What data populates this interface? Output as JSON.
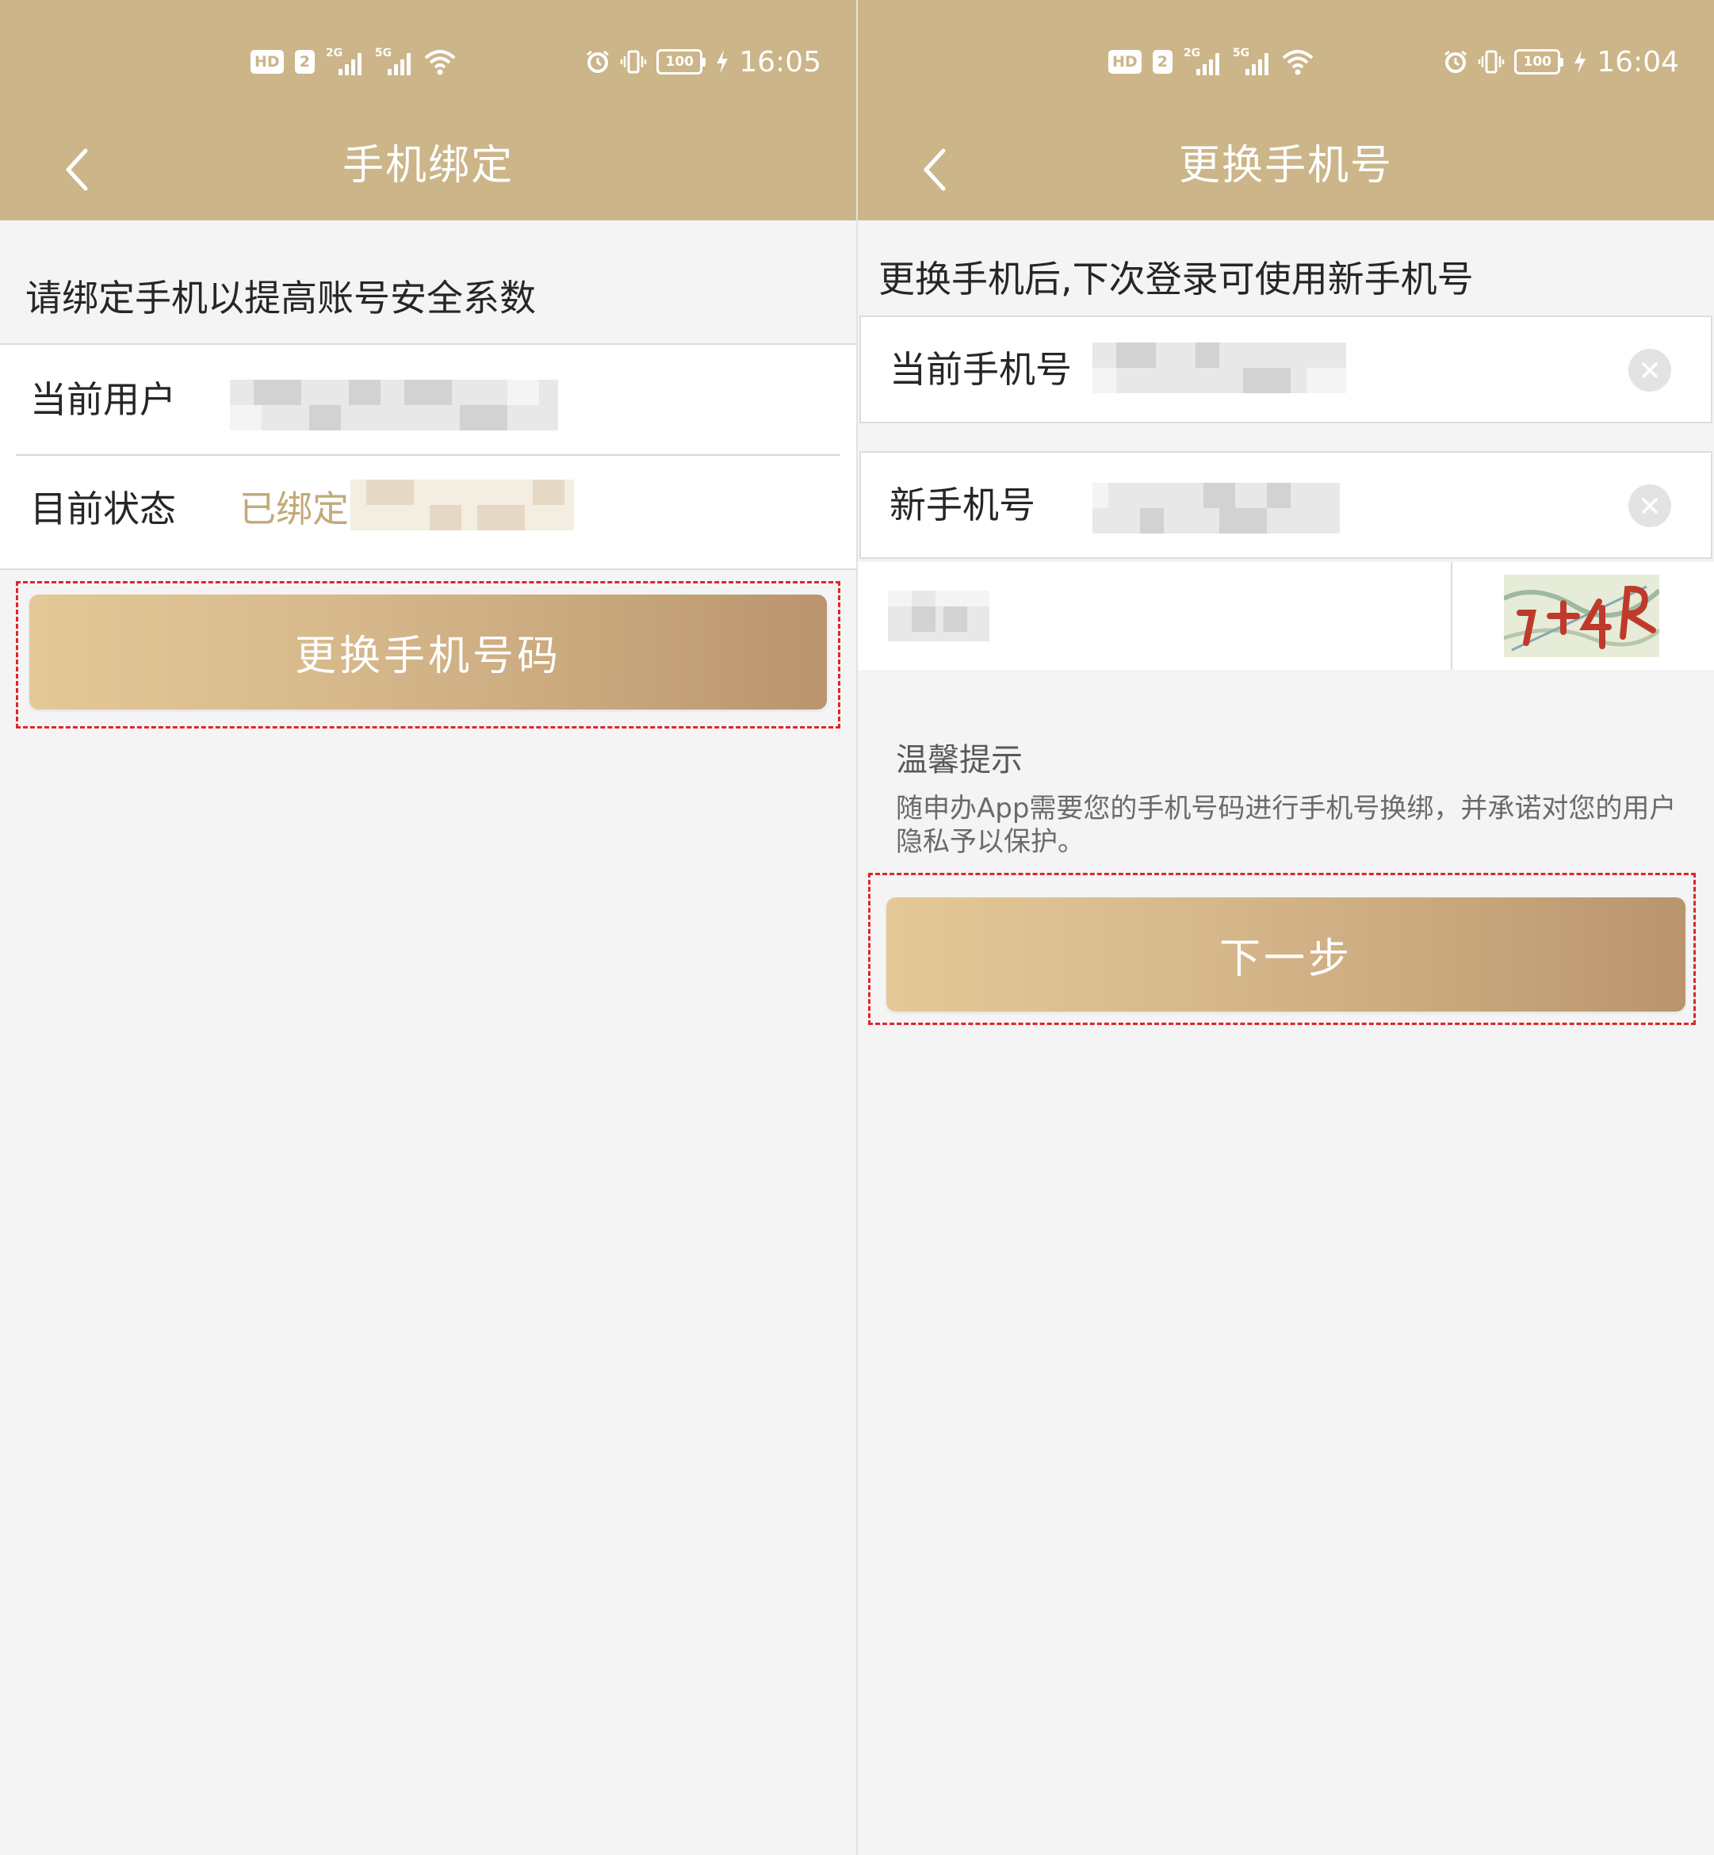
{
  "left": {
    "status": {
      "time": "16:05",
      "hd": "HD",
      "sim2": "2",
      "net1": "2G",
      "net2": "5G",
      "battery": "100"
    },
    "nav": {
      "title": "手机绑定"
    },
    "hint": "请绑定手机以提高账号安全系数",
    "rows": {
      "user_label": "当前用户",
      "status_label": "目前状态",
      "status_value": "已绑定"
    },
    "button": "更换手机号码"
  },
  "right": {
    "status": {
      "time": "16:04",
      "hd": "HD",
      "sim2": "2",
      "net1": "2G",
      "net2": "5G",
      "battery": "100"
    },
    "nav": {
      "title": "更换手机号"
    },
    "hint": "更换手机后,下次登录可使用新手机号",
    "fields": {
      "current_label": "当前手机号",
      "new_label": "新手机号"
    },
    "tips": {
      "title": "温馨提示",
      "text": "随申办App需要您的手机号码进行手机号换绑，并承诺对您的用户隐私予以保护。"
    },
    "button": "下一步"
  },
  "colors": {
    "header": "#cbb589",
    "accent": "#c2aa7a",
    "highlight": "#e1242b"
  }
}
